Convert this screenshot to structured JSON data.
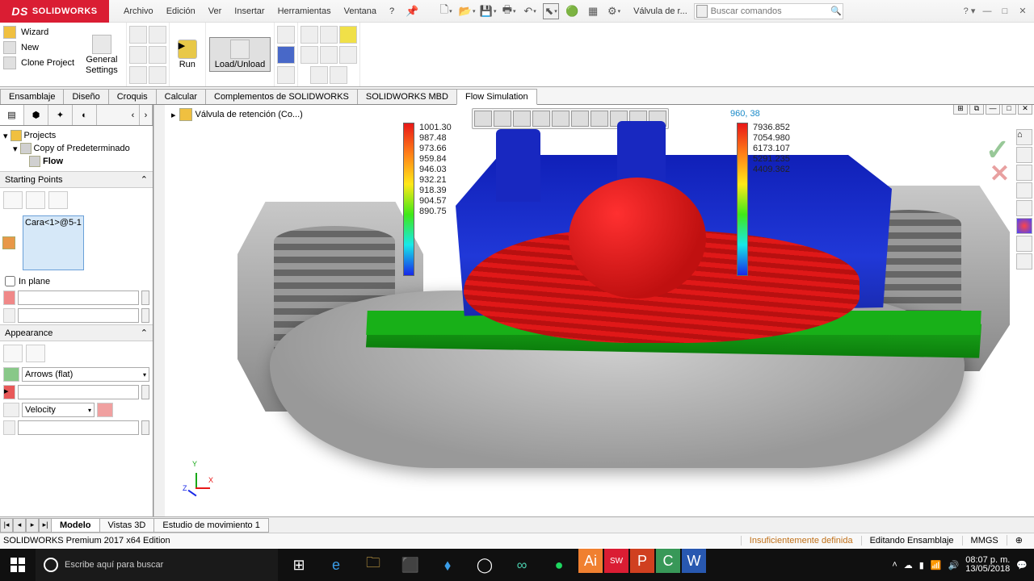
{
  "app": {
    "brand_prefix": "DS",
    "brand": "SOLIDWORKS",
    "edition": "SOLIDWORKS Premium 2017 x64 Edition"
  },
  "menus": [
    "Archivo",
    "Edición",
    "Ver",
    "Insertar",
    "Herramientas",
    "Ventana",
    "?"
  ],
  "title_tools": {
    "doc_name": "Válvula de r...",
    "search_placeholder": "Buscar comandos"
  },
  "ribbon": {
    "left": [
      {
        "label": "Wizard"
      },
      {
        "label": "New"
      },
      {
        "label": "Clone Project"
      }
    ],
    "general": {
      "label": "General",
      "label2": "Settings"
    },
    "run": {
      "label": "Run"
    },
    "load": {
      "label": "Load/Unload"
    }
  },
  "tabs": [
    "Ensamblaje",
    "Diseño",
    "Croquis",
    "Calcular",
    "Complementos de SOLIDWORKS",
    "SOLIDWORKS MBD",
    "Flow Simulation"
  ],
  "active_tab": "Flow Simulation",
  "breadcrumb": {
    "item": "Válvula de retención (Co...)"
  },
  "tree": {
    "root": "Projects",
    "child": "Copy of Predeterminado",
    "leaf": "Flow"
  },
  "sections": {
    "starting": {
      "title": "Starting Points",
      "selection": "Cara<1>@5-1",
      "in_plane": "In plane"
    },
    "appearance": {
      "title": "Appearance",
      "style": "Arrows (flat)",
      "param": "Velocity"
    }
  },
  "legend1": [
    "1001.30",
    "987.48",
    "973.66",
    "959.84",
    "946.03",
    "932.21",
    "918.39",
    "904.57",
    "890.75"
  ],
  "legend2": [
    "7936.852",
    "7054.980",
    "6173.107",
    "5291.235",
    "4409.362"
  ],
  "canvas": {
    "coord": "960, 38"
  },
  "bottom_tabs": [
    "Modelo",
    "Vistas 3D",
    "Estudio de movimiento 1"
  ],
  "status": {
    "def": "Insuficientemente definida",
    "mode": "Editando Ensamblaje",
    "units": "MMGS"
  },
  "taskbar": {
    "search": "Escribe aquí para buscar",
    "time": "08:07 p. m.",
    "date": "13/05/2018"
  }
}
